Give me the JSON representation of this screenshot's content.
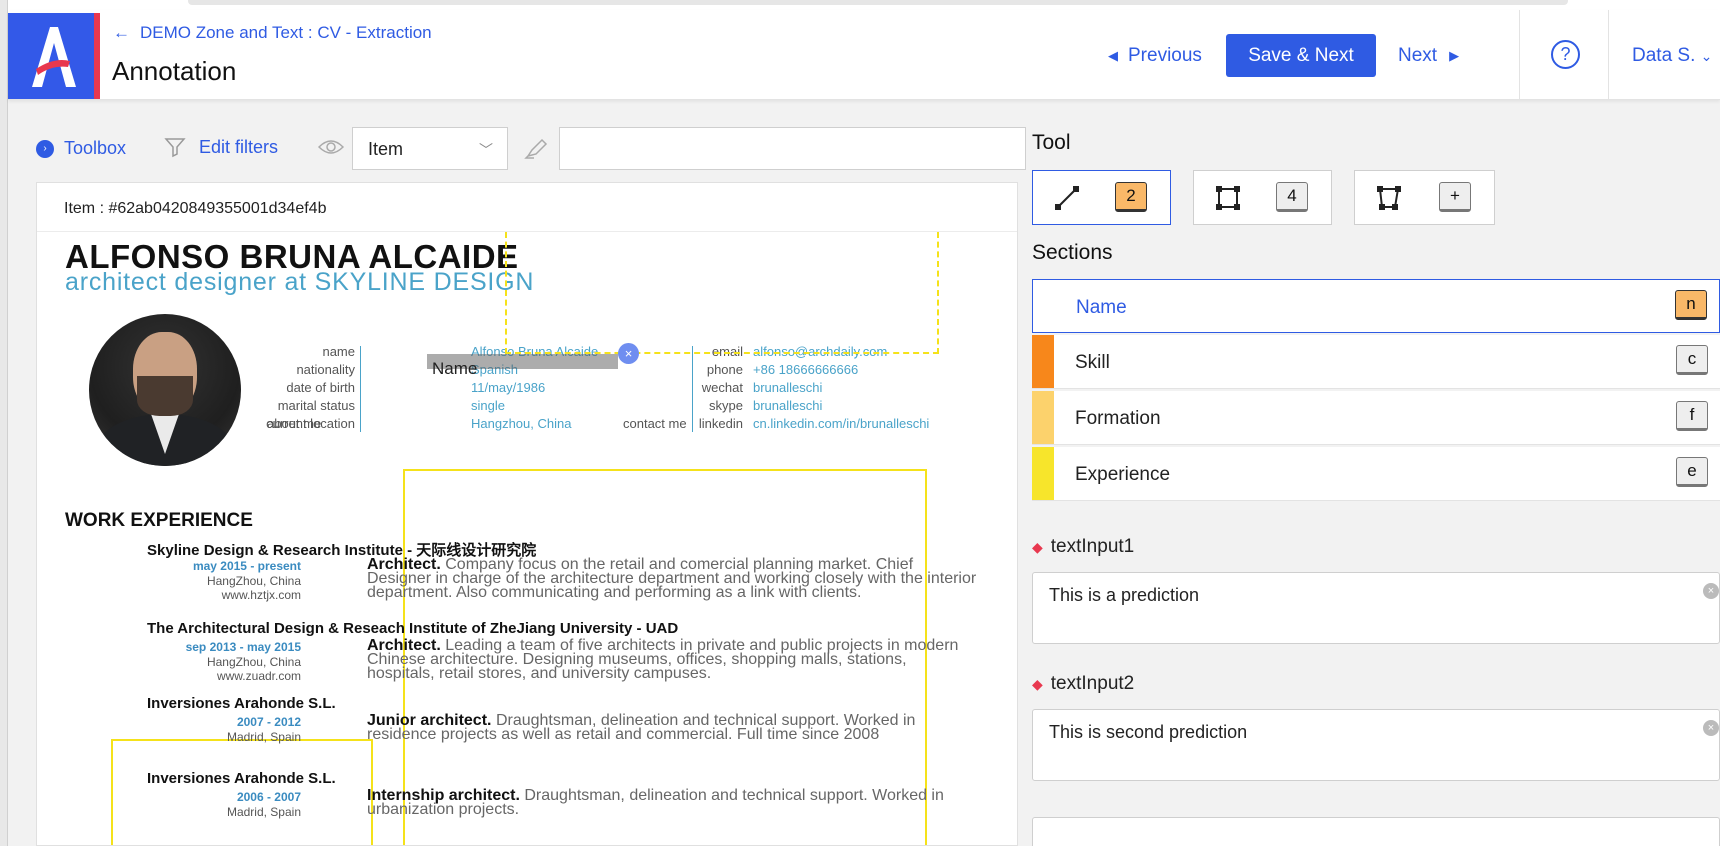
{
  "header": {
    "breadcrumb": "DEMO Zone and Text : CV - Extraction",
    "title": "Annotation",
    "previous_label": "Previous",
    "save_next_label": "Save & Next",
    "next_label": "Next",
    "help_label": "?",
    "user_label": "Data S.",
    "logo_letter": "A"
  },
  "filters": {
    "toolbox_label": "Toolbox",
    "edit_filters_label": "Edit filters",
    "view_select_value": "Item",
    "search_value": ""
  },
  "document": {
    "item_id": "Item : #62ab0420849355001d34ef4b",
    "cv": {
      "name": "ALFONSO BRUNA ALCAIDE",
      "role": "architect designer at SKYLINE DESIGN",
      "about_me": "about me",
      "contact_me": "contact me",
      "personal": [
        {
          "label": "name",
          "value": "Alfonso Bruna Alcaide"
        },
        {
          "label": "nationality",
          "value": "Spanish"
        },
        {
          "label": "date of birth",
          "value": "11/may/1986"
        },
        {
          "label": "marital status",
          "value": "single"
        },
        {
          "label": "current location",
          "value": "Hangzhou, China"
        }
      ],
      "contact": [
        {
          "label": "email",
          "value": "alfonso@archdaily.com"
        },
        {
          "label": "phone",
          "value": "+86 18666666666"
        },
        {
          "label": "wechat",
          "value": "brunalleschi"
        },
        {
          "label": "skype",
          "value": "brunalleschi"
        },
        {
          "label": "linkedin",
          "value": "cn.linkedin.com/in/brunalleschi"
        }
      ],
      "work_title": "WORK EXPERIENCE",
      "jobs": [
        {
          "company": "Skyline Design & Research Institute - 天际线设计研究院",
          "date": "may 2015 - present",
          "loc1": "HangZhou, China",
          "loc2": "www.hztjx.com",
          "role": "Architect.",
          "desc": "Company focus on the retail and comercial planning market. Chief Designer in charge of the architecture department and working closely with the interior department. Also communicating and performing as a link with clients."
        },
        {
          "company": "The Architectural Design & Reseach Institute of ZheJiang University - UAD",
          "date": "sep 2013 - may 2015",
          "loc1": "HangZhou, China",
          "loc2": "www.zuadr.com",
          "role": "Architect.",
          "desc": "Leading a team of five architects in private and public projects in modern Chinese architecture. Designing museums, offices, shopping malls, stations, hospitals, retail stores, and university campuses."
        },
        {
          "company": "Inversiones Arahonde S.L.",
          "date": "2007 - 2012",
          "loc1": "Madrid, Spain",
          "loc2": "",
          "role": "Junior architect.",
          "desc": "Draughtsman, delineation and technical support. Worked in residence projects as well as retail and commercial. Full time since 2008"
        },
        {
          "company": "Inversiones Arahonde S.L.",
          "date": "2006 - 2007",
          "loc1": "Madrid, Spain",
          "loc2": "",
          "role": "Internship architect.",
          "desc": "Draughtsman, delineation and technical support. Worked in urbanization projects."
        }
      ]
    },
    "annotation_label": "Name",
    "close_symbol": "×"
  },
  "tool": {
    "title": "Tool",
    "buttons": [
      {
        "icon": "line-tool-icon",
        "key": "2"
      },
      {
        "icon": "rectangle-tool-icon",
        "key": "4"
      },
      {
        "icon": "polygon-tool-icon",
        "key": "+"
      }
    ]
  },
  "sections": {
    "title": "Sections",
    "items": [
      {
        "label": "Name",
        "key": "n",
        "color": "#2f5be3"
      },
      {
        "label": "Skill",
        "key": "c",
        "color": "#f7871b"
      },
      {
        "label": "Formation",
        "key": "f",
        "color": "#fcd26c"
      },
      {
        "label": "Experience",
        "key": "e",
        "color": "#f7e52b"
      }
    ]
  },
  "inputs": {
    "textInput1": {
      "label": "textInput1",
      "value": "This is a prediction"
    },
    "textInput2": {
      "label": "textInput2",
      "value": "This is second prediction"
    }
  },
  "colors": {
    "accent": "#2f5be3",
    "logo_red": "#e8384f",
    "annotation_yellow": "#f5e21a"
  }
}
